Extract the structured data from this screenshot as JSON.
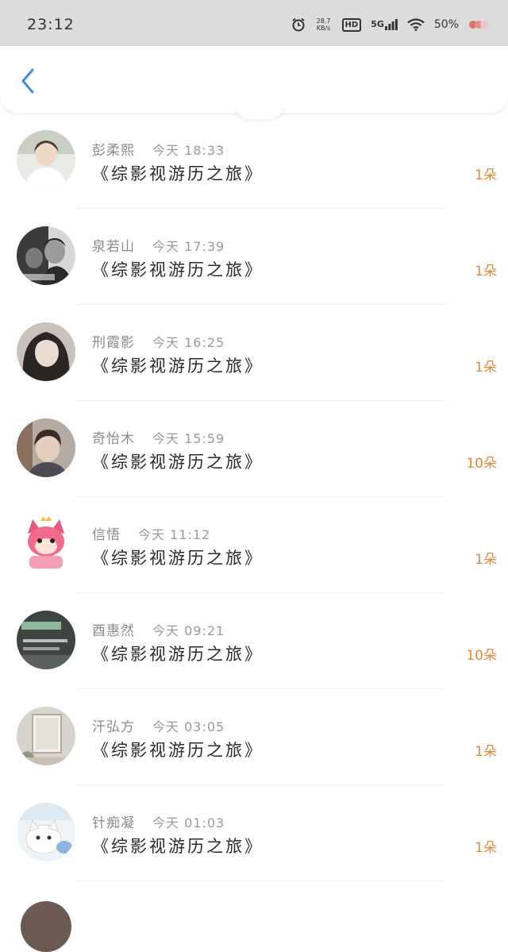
{
  "status_bar": {
    "time": "23:12",
    "net_speed": "28.7 KB/s",
    "hd": "HD",
    "network": "5G",
    "battery": "50%"
  },
  "colors": {
    "accent_back": "#3a8ee6",
    "count_orange": "#e58a3c"
  },
  "list": [
    {
      "name": "彭柔熙",
      "time": "今天 18:33",
      "title": "《综影视游历之旅》",
      "count": "1朵",
      "avatar": "person-white-shirt"
    },
    {
      "name": "泉若山",
      "time": "今天 17:39",
      "title": "《综影视游历之旅》",
      "count": "1朵",
      "avatar": "bw-couple-photo"
    },
    {
      "name": "刑霞影",
      "time": "今天 16:25",
      "title": "《综影视游历之旅》",
      "count": "1朵",
      "avatar": "girl-portrait"
    },
    {
      "name": "奇怡木",
      "time": "今天 15:59",
      "title": "《综影视游历之旅》",
      "count": "10朵",
      "avatar": "boy-portrait"
    },
    {
      "name": "信悟",
      "time": "今天 11:12",
      "title": "《综影视游历之旅》",
      "count": "1朵",
      "avatar": "pink-fox-cartoon"
    },
    {
      "name": "酉惠然",
      "time": "今天 09:21",
      "title": "《综影视游历之旅》",
      "count": "10朵",
      "avatar": "dark-text-image"
    },
    {
      "name": "汗弘方",
      "time": "今天 03:05",
      "title": "《综影视游历之旅》",
      "count": "1朵",
      "avatar": "frame-wall-photo"
    },
    {
      "name": "针痴凝",
      "time": "今天 01:03",
      "title": "《综影视游历之旅》",
      "count": "1朵",
      "avatar": "baby-cat-photo"
    }
  ]
}
